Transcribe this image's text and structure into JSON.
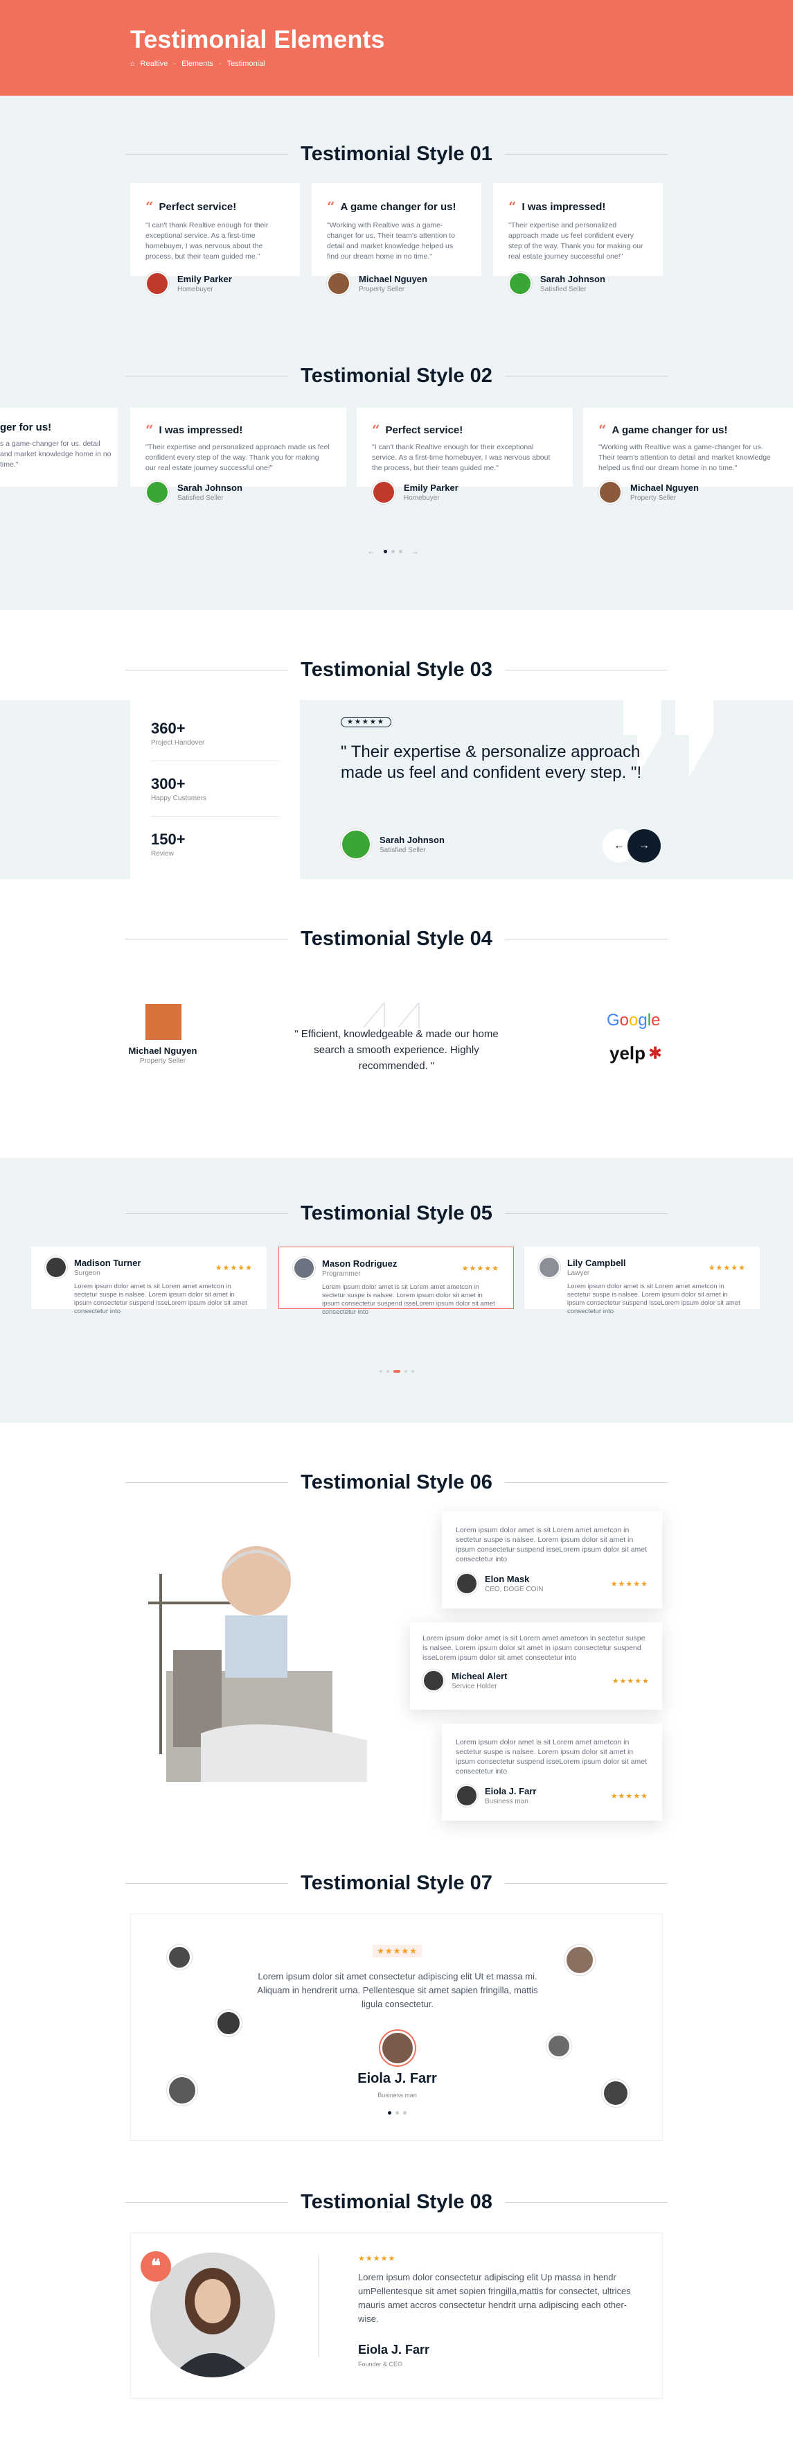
{
  "hero": {
    "title": "Testimonial Elements",
    "crumbs": [
      "Realtive",
      "Elements",
      "Testimonial"
    ]
  },
  "s1": {
    "title": "Testimonial Style 01",
    "cards": [
      {
        "title": "Perfect service!",
        "text": "\"I can't thank Realtive enough for their exceptional service. As a first-time homebuyer, I was nervous about the process, but their team guided me.\"",
        "name": "Emily Parker",
        "role": "Homebuyer"
      },
      {
        "title": "A game changer for us!",
        "text": "\"Working with Realtive was a game-changer for us. Their team's attention to detail and market knowledge helped us find our dream home in no time.\"",
        "name": "Michael Nguyen",
        "role": "Property Seller"
      },
      {
        "title": "I was impressed!",
        "text": "\"Their expertise and personalized approach made us feel confident every step of the way. Thank you for making our real estate journey successful one!\"",
        "name": "Sarah Johnson",
        "role": "Satisfied Seller"
      }
    ]
  },
  "s2": {
    "title": "Testimonial Style 02",
    "partial": {
      "title": "ger for us!",
      "text": "s a game-changer for us. detail and market knowledge home in no time.\"",
      "name": "uyen"
    },
    "cards": [
      {
        "title": "I was impressed!",
        "text": "\"Their expertise and personalized approach made us feel confident every step of the way. Thank you for making our real estate journey successful one!\"",
        "name": "Sarah Johnson",
        "role": "Satisfied Seller"
      },
      {
        "title": "Perfect service!",
        "text": "\"I can't thank Realtive enough for their exceptional service. As a first-time homebuyer, I was nervous about the process, but their team guided me.\"",
        "name": "Emily Parker",
        "role": "Homebuyer"
      },
      {
        "title": "A game changer for us!",
        "text": "\"Working with Realtive was a game-changer for us. Their team's attention to detail and market knowledge helped us find our dream home in no time.\"",
        "name": "Michael Nguyen",
        "role": "Property Seller"
      }
    ],
    "prev": "←",
    "next": "→"
  },
  "s3": {
    "title": "Testimonial Style 03",
    "stats": [
      {
        "value": "360+",
        "label": "Project Handover"
      },
      {
        "value": "300+",
        "label": "Happy Customers"
      },
      {
        "value": "150+",
        "label": "Review"
      }
    ],
    "stars": "★★★★★",
    "quote": "\" Their expertise & personalize approach made us feel and confident every step. \"!",
    "name": "Sarah Johnson",
    "role": "Satisfied Seller",
    "prev": "←",
    "next": "→"
  },
  "s4": {
    "title": "Testimonial Style 04",
    "name": "Michael Nguyen",
    "role": "Property Seller",
    "quote": "\" Efficient, knowledgeable & made our home search a smooth experience. Highly recommended. \"",
    "google": [
      "G",
      "o",
      "o",
      "g",
      "l",
      "e"
    ],
    "yelp": "yelp"
  },
  "s5": {
    "title": "Testimonial Style 05",
    "cards": [
      {
        "name": "Madison Turner",
        "role": "Surgeon",
        "stars": "★★★★★",
        "text": "Lorem ipsum dolor amet is sit Lorem amet ametcon in sectetur suspe is nalsee. Lorem ipsum dolor sit amet in ipsum consectetur suspend isseLorem ipsum dolor sit amet consectetur into"
      },
      {
        "name": "Mason Rodriguez",
        "role": "Programmer",
        "stars": "★★★★★",
        "text": "Lorem ipsum dolor amet is sit Lorem amet ametcon in sectetur suspe is nalsee. Lorem ipsum dolor sit amet in ipsum consectetur suspend isseLorem ipsum dolor sit amet consectetur into"
      },
      {
        "name": "Lily Campbell",
        "role": "Lawyer",
        "stars": "★★★★★",
        "text": "Lorem ipsum dolor amet is sit Lorem amet ametcon in sectetur suspe is nalsee. Lorem ipsum dolor sit amet in ipsum consectetur suspend isseLorem ipsum dolor sit amet consectetur into"
      }
    ]
  },
  "s6": {
    "title": "Testimonial Style 06",
    "cards": [
      {
        "text": "Lorem ipsum dolor amet is sit Lorem amet ametcon in sectetur suspe is nalsee. Lorem ipsum dolor sit amet in ipsum consectetur suspend isseLorem ipsum dolor sit amet consectetur into",
        "name": "Elon Mask",
        "role": "CEO, DOGE COIN",
        "stars": "★★★★★"
      },
      {
        "text": "Lorem ipsum dolor amet is sit Lorem amet ametcon in sectetur suspe is nalsee. Lorem ipsum dolor sit amet in ipsum consectetur suspend isseLorem ipsum dolor sit amet consectetur into",
        "name": "Micheal Alert",
        "role": "Service Holder",
        "stars": "★★★★★"
      },
      {
        "text": "Lorem ipsum dolor amet is sit Lorem amet ametcon in sectetur suspe is nalsee. Lorem ipsum dolor sit amet in ipsum consectetur suspend isseLorem ipsum dolor sit amet consectetur into",
        "name": "Eiola J. Farr",
        "role": "Business man",
        "stars": "★★★★★"
      }
    ]
  },
  "s7": {
    "title": "Testimonial Style 07",
    "stars": "★★★★★",
    "text": "Lorem ipsum dolor sit amet consectetur adipiscing elit Ut et massa mi. Aliquam in hendrerit urna. Pellentesque sit amet sapien fringilla, mattis ligula consectetur.",
    "name": "Eiola J. Farr",
    "role": "Business man"
  },
  "s8": {
    "title": "Testimonial Style 08",
    "stars": "★★★★★",
    "text": "Lorem ipsum dolor consectetur adipiscing elit Up massa in hendr umPellentesque sit amet sopien fringilla,mattis for consectet, ultrices mauris amet accros consectetur hendrit urna adipiscing each other-wise.",
    "name": "Eiola J. Farr",
    "role": "Founder & CEO"
  }
}
